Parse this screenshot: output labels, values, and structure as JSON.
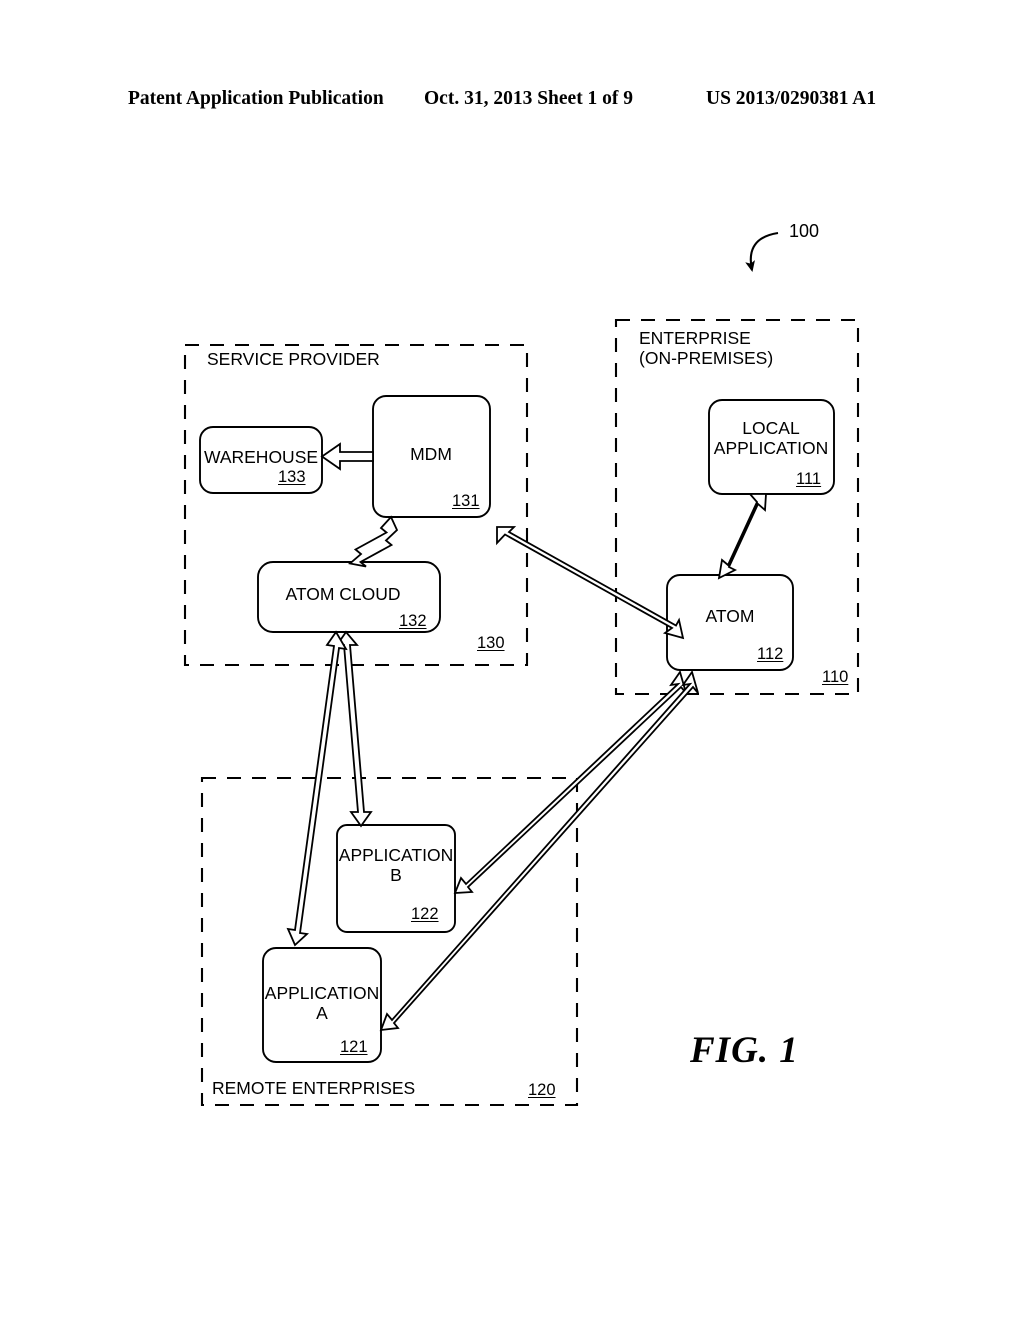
{
  "header": {
    "left": "Patent Application Publication",
    "middle": "Oct. 31, 2013  Sheet 1 of 9",
    "right": "US 2013/0290381 A1"
  },
  "figure": {
    "caption": "FIG. 1",
    "system_ref": "100"
  },
  "groups": [
    {
      "id": "service-provider",
      "label": "SERVICE PROVIDER",
      "ref": "130"
    },
    {
      "id": "enterprise",
      "label_line1": "ENTERPRISE",
      "label_line2": "(ON-PREMISES)",
      "ref": "110"
    },
    {
      "id": "remote-enterprises",
      "label": "REMOTE ENTERPRISES",
      "ref": "120"
    }
  ],
  "nodes": [
    {
      "id": "warehouse",
      "label": "WAREHOUSE",
      "ref": "133"
    },
    {
      "id": "mdm",
      "label": "MDM",
      "ref": "131"
    },
    {
      "id": "atom-cloud",
      "label": "ATOM CLOUD",
      "ref": "132"
    },
    {
      "id": "local-application",
      "label_line1": "LOCAL",
      "label_line2": "APPLICATION",
      "ref": "111"
    },
    {
      "id": "atom",
      "label": "ATOM",
      "ref": "112"
    },
    {
      "id": "application-b",
      "label_line1": "APPLICATION",
      "label_line2": "B",
      "ref": "122"
    },
    {
      "id": "application-a",
      "label_line1": "APPLICATION",
      "label_line2": "A",
      "ref": "121"
    }
  ],
  "connections": [
    {
      "id": "mdm-to-warehouse",
      "from": "mdm",
      "to": "warehouse",
      "direction": "one-way"
    },
    {
      "id": "mdm-atom-cloud",
      "from": "mdm",
      "to": "atom-cloud",
      "direction": "two-way"
    },
    {
      "id": "mdm-atom",
      "from": "mdm",
      "to": "atom",
      "direction": "two-way"
    },
    {
      "id": "atom-local-application",
      "from": "atom",
      "to": "local-application",
      "direction": "two-way"
    },
    {
      "id": "atom-cloud-application-b",
      "from": "atom-cloud",
      "to": "application-b",
      "direction": "two-way"
    },
    {
      "id": "atom-cloud-application-a",
      "from": "atom-cloud",
      "to": "application-a",
      "direction": "two-way"
    },
    {
      "id": "atom-application-b",
      "from": "atom",
      "to": "application-b",
      "direction": "two-way"
    },
    {
      "id": "atom-application-a",
      "from": "atom",
      "to": "application-a",
      "direction": "two-way"
    }
  ],
  "colors": {
    "line": "#000000",
    "background": "#ffffff"
  }
}
